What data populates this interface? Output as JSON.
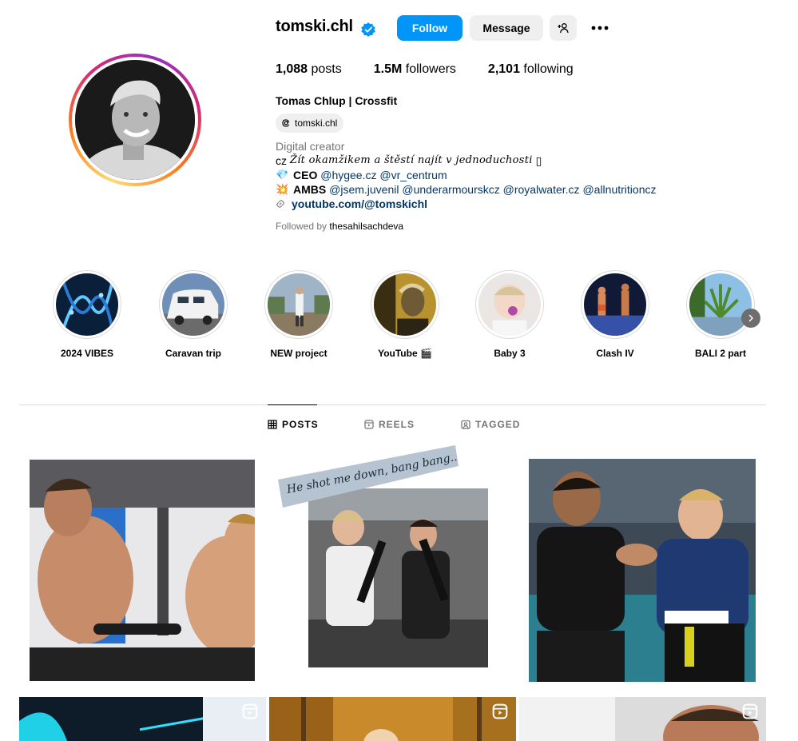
{
  "profile": {
    "username": "tomski.chl",
    "full_name": "Tomas Chlup | Crossfit",
    "threads_handle": "tomski.chl",
    "category": "Digital creator",
    "verified": true
  },
  "actions": {
    "follow_label": "Follow",
    "message_label": "Message"
  },
  "stats": {
    "posts_count": "1,088",
    "posts_label": "posts",
    "followers_count": "1.5M",
    "followers_label": "followers",
    "following_count": "2,101",
    "following_label": "following"
  },
  "bio": {
    "line1_prefix": "cz",
    "line1_script": "Žít okamžikem a štěstí najít v jednoduchosti",
    "line1_suffix": "▯",
    "line2_emoji": "💎",
    "line2_label": "CEO",
    "line2_tags": [
      "@hygee.cz",
      "@vr_centrum"
    ],
    "line3_emoji": "💥",
    "line3_label": "AMBS",
    "line3_tags": [
      "@jsem.juvenil",
      "@underarmourskcz",
      "@royalwater.cz",
      "@allnutritioncz"
    ],
    "link": "youtube.com/@tomskichl",
    "followed_by_prefix": "Followed by",
    "followed_by_user": "thesahilsachdeva"
  },
  "highlights": [
    {
      "label": "2024 VIBES"
    },
    {
      "label": "Caravan trip"
    },
    {
      "label": "NEW project"
    },
    {
      "label": "YouTube 🎬"
    },
    {
      "label": "Baby 3"
    },
    {
      "label": "Clash IV"
    },
    {
      "label": "BALI 2 part"
    }
  ],
  "tabs": {
    "posts": "POSTS",
    "reels": "REELS",
    "tagged": "TAGGED"
  },
  "posts": [
    {
      "overlay_text": ""
    },
    {
      "overlay_text": "He shot me down, bang bang.."
    },
    {
      "overlay_text": ""
    },
    {
      "overlay_text": ""
    },
    {
      "overlay_text": ""
    },
    {
      "overlay_text": ""
    }
  ],
  "icons": {
    "verified": "verified-badge-icon",
    "add_user": "add-user-icon",
    "more": "more-options-icon",
    "threads": "threads-icon",
    "link": "link-icon",
    "chevron": "chevron-right-icon",
    "grid": "grid-icon",
    "reels": "reels-icon",
    "tagged": "tagged-icon"
  },
  "colors": {
    "accent": "#0095f6",
    "secondary_button": "#efefef",
    "muted_text": "#737373",
    "link_text": "#00376b"
  }
}
